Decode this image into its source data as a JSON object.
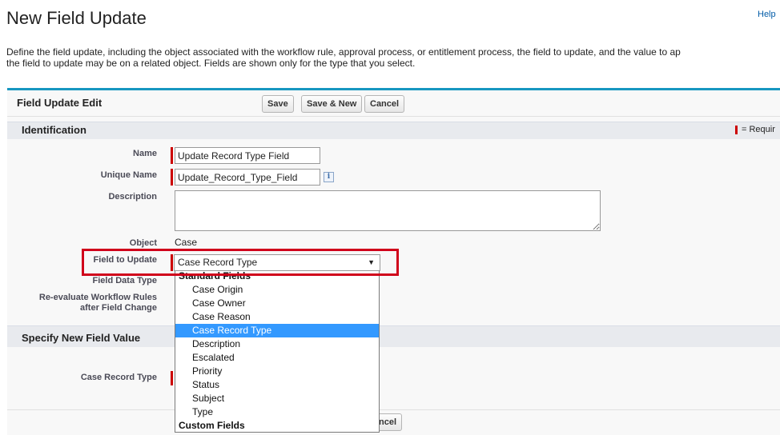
{
  "page": {
    "title": "New Field Update",
    "help_link": "Help",
    "intro_line1": "Define the field update, including the object associated with the workflow rule, approval process, or entitlement process, the field to update, and the value to ap",
    "intro_line2": "the field to update may be on a related object. Fields are shown only for the type that you select."
  },
  "panel": {
    "title": "Field Update Edit",
    "save_label": "Save",
    "save_new_label": "Save & New",
    "cancel_label": "Cancel",
    "cancel_partial_label": "ncel"
  },
  "identification": {
    "title": "Identification",
    "required_legend": "= Requir",
    "name_label": "Name",
    "name_value": "Update Record Type Field",
    "unique_name_label": "Unique Name",
    "unique_name_value": "Update_Record_Type_Field",
    "info_glyph": "i",
    "description_label": "Description",
    "description_value": "",
    "object_label": "Object",
    "object_value": "Case",
    "field_to_update_label": "Field to Update",
    "field_to_update_value": "Case Record Type",
    "field_data_type_label": "Field Data Type",
    "reevaluate_label_line1": "Re-evaluate Workflow Rules",
    "reevaluate_label_line2": "after Field Change"
  },
  "dropdown": {
    "items": [
      {
        "label": "Standard Fields",
        "group": true
      },
      {
        "label": "Case Origin"
      },
      {
        "label": "Case Owner"
      },
      {
        "label": "Case Reason"
      },
      {
        "label": "Case Record Type",
        "selected": true
      },
      {
        "label": "Description"
      },
      {
        "label": "Escalated"
      },
      {
        "label": "Priority"
      },
      {
        "label": "Status"
      },
      {
        "label": "Subject"
      },
      {
        "label": "Type"
      },
      {
        "label": "Custom Fields",
        "group": true
      }
    ]
  },
  "new_value": {
    "title": "Specify New Field Value",
    "case_record_type_label": "Case Record Type"
  },
  "colors": {
    "accent": "#1797c0",
    "required": "#cc0000",
    "highlight": "#d0021b",
    "selection": "#3399ff"
  }
}
